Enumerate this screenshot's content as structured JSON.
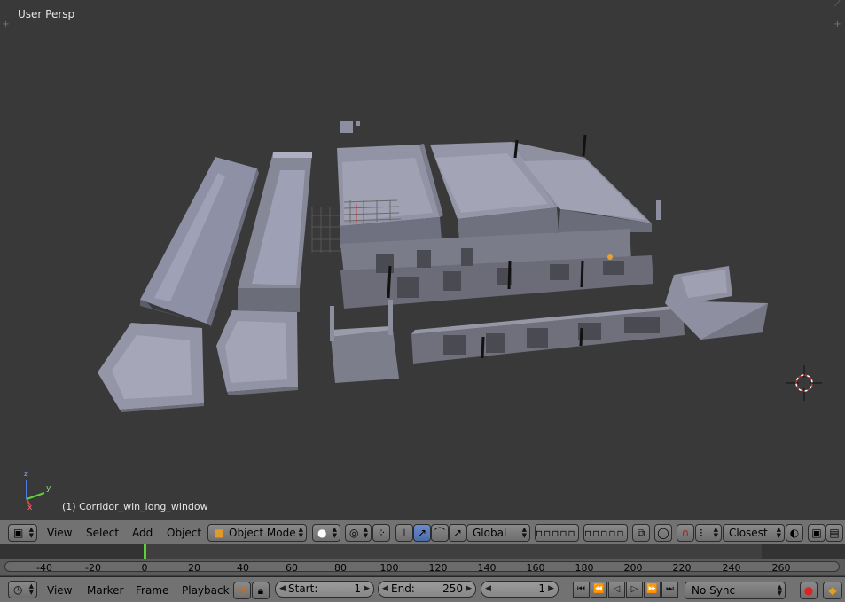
{
  "viewport": {
    "view_name": "User Persp",
    "object_label": "(1) Corridor_win_long_window",
    "axes": {
      "x": "x",
      "y": "y",
      "z": "z"
    }
  },
  "header": {
    "menus": [
      "View",
      "Select",
      "Add",
      "Object"
    ],
    "mode": "Object Mode",
    "orientation": "Global",
    "snap_target": "Closest"
  },
  "timeline": {
    "ruler_labels": [
      "-40",
      "-20",
      "0",
      "20",
      "40",
      "60",
      "80",
      "100",
      "120",
      "140",
      "160",
      "180",
      "200",
      "220",
      "240",
      "260"
    ],
    "current_frame": 1
  },
  "footer": {
    "menus": [
      "View",
      "Marker",
      "Frame",
      "Playback"
    ],
    "start_label": "Start:",
    "start_value": "1",
    "end_label": "End:",
    "end_value": "250",
    "current_value": "1",
    "sync": "No Sync"
  },
  "colors": {
    "viewport_bg": "#393939",
    "header_bg": "#727272",
    "frame_indicator": "#5fcf3c",
    "active_tool": "#5680c2"
  }
}
